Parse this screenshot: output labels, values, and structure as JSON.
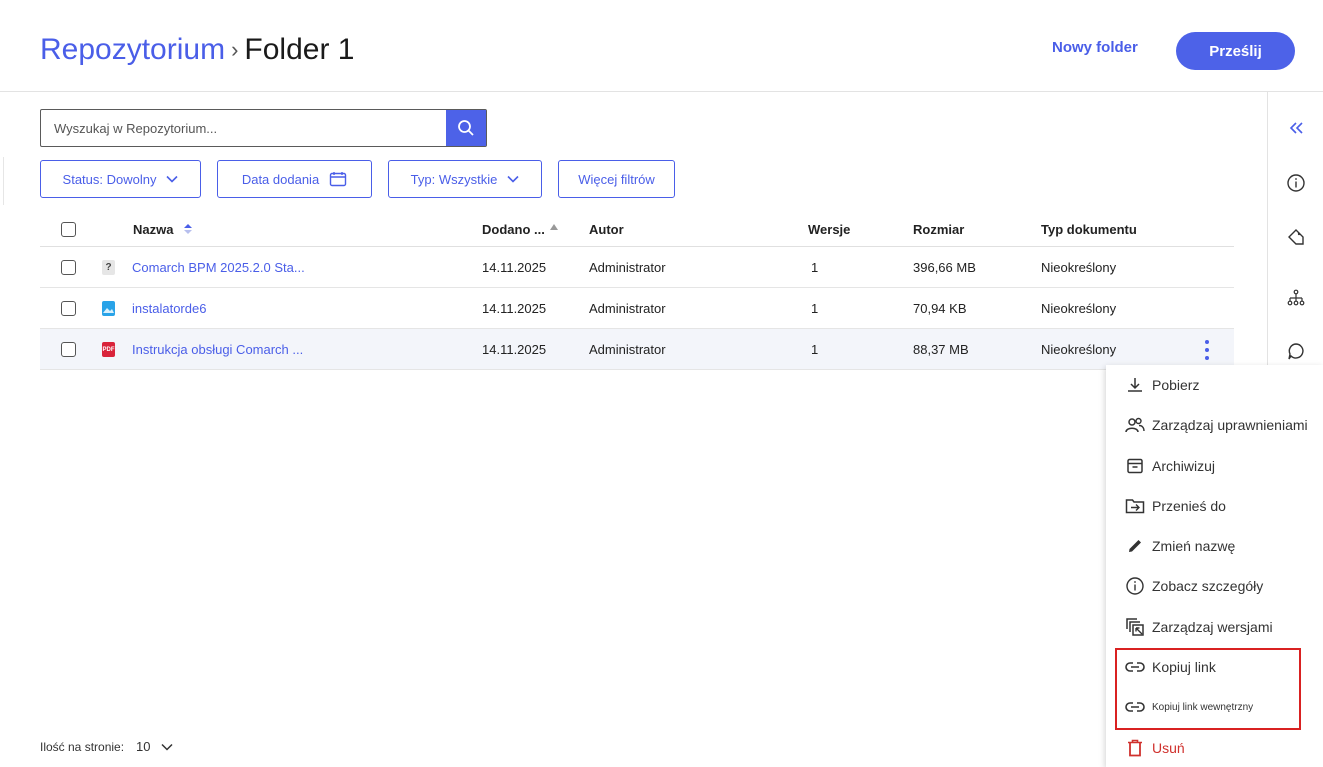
{
  "header": {
    "breadcrumb_root": "Repozytorium",
    "breadcrumb_sep": "›",
    "breadcrumb_current": "Folder 1",
    "new_folder": "Nowy folder",
    "upload": "Prześlij"
  },
  "search": {
    "placeholder": "Wyszukaj w Repozytorium..."
  },
  "filters": {
    "status": "Status: Dowolny",
    "date": "Data dodania",
    "type": "Typ: Wszystkie",
    "more": "Więcej filtrów"
  },
  "table": {
    "headers": {
      "name": "Nazwa",
      "added": "Dodano ...",
      "author": "Autor",
      "versions": "Wersje",
      "size": "Rozmiar",
      "doc_type": "Typ dokumentu"
    },
    "rows": [
      {
        "icon": "unknown-file-icon",
        "name": "Comarch BPM 2025.2.0 Sta...",
        "added": "14.11.2025",
        "author": "Administrator",
        "versions": "1",
        "size": "396,66 MB",
        "doc_type": "Nieokreślony"
      },
      {
        "icon": "image-file-icon",
        "name": "instalatorde6",
        "added": "14.11.2025",
        "author": "Administrator",
        "versions": "1",
        "size": "70,94 KB",
        "doc_type": "Nieokreślony"
      },
      {
        "icon": "pdf-file-icon",
        "icon_text": "PDF",
        "name": "Instrukcja obsługi Comarch ...",
        "added": "14.11.2025",
        "author": "Administrator",
        "versions": "1",
        "size": "88,37 MB",
        "doc_type": "Nieokreślony"
      }
    ]
  },
  "context_menu": {
    "items": [
      {
        "icon": "download-icon",
        "label": "Pobierz"
      },
      {
        "icon": "people-icon",
        "label": "Zarządzaj uprawnieniami"
      },
      {
        "icon": "archive-icon",
        "label": "Archiwizuj"
      },
      {
        "icon": "move-folder-icon",
        "label": "Przenieś do"
      },
      {
        "icon": "pencil-icon",
        "label": "Zmień nazwę"
      },
      {
        "icon": "info-icon",
        "label": "Zobacz szczegóły"
      },
      {
        "icon": "versions-icon",
        "label": "Zarządzaj wersjami"
      },
      {
        "icon": "link-icon",
        "label": "Kopiuj link"
      },
      {
        "icon": "link-icon",
        "label": "Kopiuj link wewnętrzny"
      },
      {
        "icon": "trash-icon",
        "label": "Usuń"
      }
    ]
  },
  "footer": {
    "per_page_label": "Ilość na stronie:",
    "per_page_value": "10"
  },
  "colors": {
    "accent": "#4d62e8",
    "danger": "#d0312d",
    "highlight": "#d92121",
    "pdf": "#d9233a",
    "image": "#29a3e8"
  }
}
